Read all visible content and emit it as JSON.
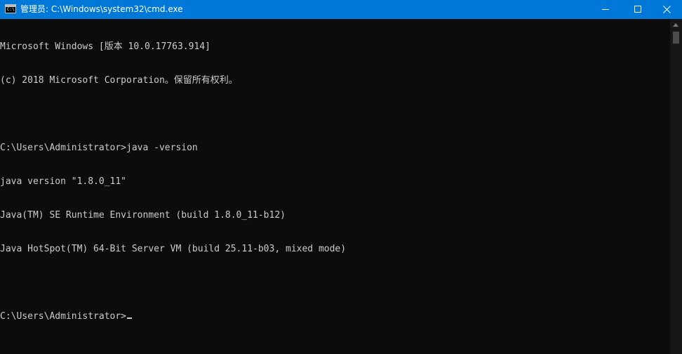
{
  "window": {
    "title": "管理员: C:\\Windows\\system32\\cmd.exe",
    "icon": "cmd-icon",
    "accent_color": "#0078d7",
    "background_color": "#0c0c0c",
    "text_color": "#cccccc"
  },
  "titlebar_buttons": {
    "minimize_icon": "minimize-icon",
    "maximize_icon": "maximize-icon",
    "close_icon": "close-icon"
  },
  "console": {
    "lines": [
      "Microsoft Windows [版本 10.0.17763.914]",
      "(c) 2018 Microsoft Corporation。保留所有权利。",
      "",
      "C:\\Users\\Administrator>java -version",
      "java version \"1.8.0_11\"",
      "Java(TM) SE Runtime Environment (build 1.8.0_11-b12)",
      "Java HotSpot(TM) 64-Bit Server VM (build 25.11-b03, mixed mode)",
      "",
      "C:\\Users\\Administrator>"
    ]
  }
}
